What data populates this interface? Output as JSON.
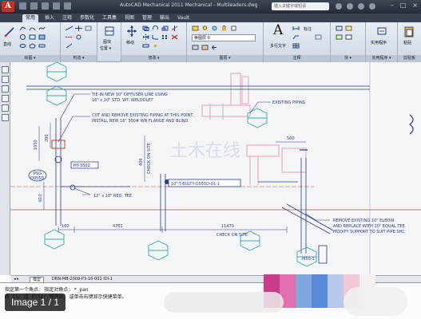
{
  "window": {
    "app_button_label": "A",
    "title": "AutoCAD Mechanical 2011   Mechanical - Multileaders.dwg",
    "search_placeholder": "键入关键字或短语",
    "window_controls": [
      "–",
      "□",
      "×"
    ]
  },
  "ribbon_tabs": [
    {
      "label": "常用",
      "active": true
    },
    {
      "label": "插入",
      "active": false
    },
    {
      "label": "注释",
      "active": false
    },
    {
      "label": "参数化",
      "active": false
    },
    {
      "label": "工具集",
      "active": false
    },
    {
      "label": "视图",
      "active": false
    },
    {
      "label": "管理",
      "active": false
    },
    {
      "label": "输出",
      "active": false
    },
    {
      "label": "Vault",
      "active": false
    }
  ],
  "ribbon": {
    "panels": [
      {
        "label": "绘图 ▾"
      },
      {
        "label": "构造 ▾"
      },
      {
        "label": "修改 ▾"
      },
      {
        "label": "图层 ▾"
      },
      {
        "label": "注释"
      },
      {
        "label": "块 ▾"
      },
      {
        "label": "实用程序 ▾"
      },
      {
        "label": "剪贴板"
      }
    ],
    "buttons": {
      "line": "直线",
      "block": "图块",
      "position": "位置 ▾",
      "move": "移动",
      "layer_combo": "等图层 0",
      "text": "多行文字",
      "dimension": "标注",
      "utilities": "实用程序",
      "paste": "粘贴"
    },
    "text_letter": "A"
  },
  "drawing": {
    "annotations": {
      "tie_in": "TIE-IN NEW 10\" DIFFUSER LINE USING",
      "tie_in2": "16\" x 10\" STD. WT. WELDOLET",
      "cut": "CUT AND REMOVE EXISTING PIPING AT THIS POINT,",
      "cut2": "INSTALL NEW 16\" 300# WN FLANGE AND BLIND.",
      "existing": "EXISTING PIPING",
      "red_tee": "12\" x 10\" RED. TEE",
      "line_tag": "10\"-T-BULTY-D055D-01-1",
      "remove1": "REMOVE EXISTING 10\" ELBOW",
      "remove2": "AND REPLACE WITH 10\" EQUAL TEE",
      "remove3": "MODIFY SUPPORT TO SUIT PIPE SHC",
      "check1": "CHECK ON SITE",
      "check2": "CHECK ON SITE",
      "psg": "PSG",
      "psg_num": "D055D",
      "tag_hy": "HY-3502",
      "dim_100": "100",
      "dim_4761": "4761",
      "dim_11470": "11470",
      "dim_500": "500",
      "dim_200": "200",
      "dim_1050": "1050",
      "dim_610": "610",
      "dim_400": "400",
      "pipe_tag": "M50-1",
      "watermark": "土木在线"
    }
  },
  "layout_tabs": {
    "model": "模型",
    "layout": "DRN-MB-2000-P3-16-001 IDI-1"
  },
  "command_line": {
    "line1": "指定第一个角点: 指定对角点: *_pan",
    "line2": "按 Esc 或 Enter 键退出, 或单击右键显示快捷菜单。"
  },
  "image_label": "Image 1 / 1",
  "colors": {
    "drawing_blue": "#2b3a8c",
    "cyan_symbol": "#3aa6a8",
    "red_line": "#d83a3a",
    "titlebar": "#2b323d"
  }
}
